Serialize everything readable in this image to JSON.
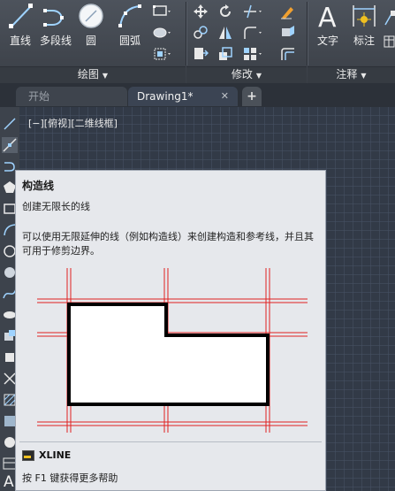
{
  "ribbon": {
    "draw_tools": [
      {
        "label": "直线",
        "icon": "line-icon"
      },
      {
        "label": "多段线",
        "icon": "polyline-icon"
      },
      {
        "label": "圆",
        "icon": "circle-icon"
      },
      {
        "label": "圆弧",
        "icon": "arc-icon"
      }
    ],
    "panels": {
      "draw": "绘图",
      "modify": "修改",
      "annotate": "注释"
    },
    "annotate_tools": [
      {
        "label": "文字",
        "icon": "text-icon"
      },
      {
        "label": "标注",
        "icon": "dimension-icon"
      }
    ]
  },
  "tabs": {
    "start": "开始",
    "drawing": "Drawing1*",
    "close": "✕",
    "new": "+"
  },
  "viewport": {
    "label": "[−][俯视][二维线框]"
  },
  "tooltip": {
    "title": "构造线",
    "description": "创建无限长的线",
    "body": "可以使用无限延伸的线（例如构造线）来创建构造和参考线，并且其可用于修剪边界。",
    "command": "XLINE",
    "help": "按 F1 键获得更多帮助"
  },
  "colors": {
    "ribbon_bg": "#444a52",
    "canvas_bg": "#323a47",
    "tooltip_bg": "#e6e8ec",
    "construction_line": "#e02020",
    "accent_yellow": "#f0c020"
  }
}
